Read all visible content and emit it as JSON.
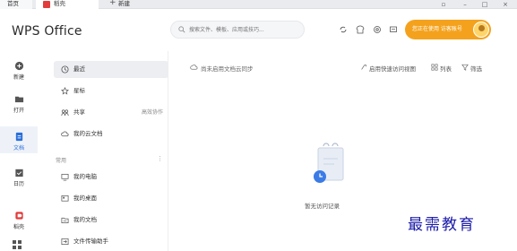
{
  "tabs": {
    "home_label": "首页",
    "active_label": "稻壳",
    "new_label": "新建"
  },
  "header": {
    "brand": "WPS Office",
    "search_placeholder": "搜索文件、模板、应用或技巧...",
    "upgrade_label": "您正在使用 访客账号"
  },
  "rail": {
    "items": [
      {
        "label": "新建",
        "icon": "plus-circle-icon"
      },
      {
        "label": "打开",
        "icon": "folder-icon"
      },
      {
        "label": "文档",
        "icon": "document-icon"
      },
      {
        "label": "日历",
        "icon": "calendar-icon"
      },
      {
        "label": "稻壳",
        "icon": "docer-icon"
      }
    ]
  },
  "nav": {
    "items": [
      {
        "label": "最近",
        "icon": "clock-icon"
      },
      {
        "label": "星标",
        "icon": "star-icon"
      },
      {
        "label": "共享",
        "icon": "share-icon",
        "right": "高效协作"
      },
      {
        "label": "我的云文档",
        "icon": "cloud-icon"
      }
    ],
    "section_title": "常用",
    "common": [
      {
        "label": "我的电脑",
        "icon": "computer-icon"
      },
      {
        "label": "我的桌面",
        "icon": "desktop-icon"
      },
      {
        "label": "我的文档",
        "icon": "folder-docs-icon"
      },
      {
        "label": "文件传输助手",
        "icon": "transfer-icon"
      }
    ]
  },
  "main": {
    "cloud_hint": "尚未启用文档云同步",
    "quick_view": "启用快速访问视图",
    "list_label": "列表",
    "filter_label": "筛选",
    "empty_text": "暂无访问记录"
  },
  "watermark": "最需教育",
  "colors": {
    "accent": "#2a6fdb",
    "upgrade": "#f4a21d",
    "brand_red": "#e23b3b"
  }
}
